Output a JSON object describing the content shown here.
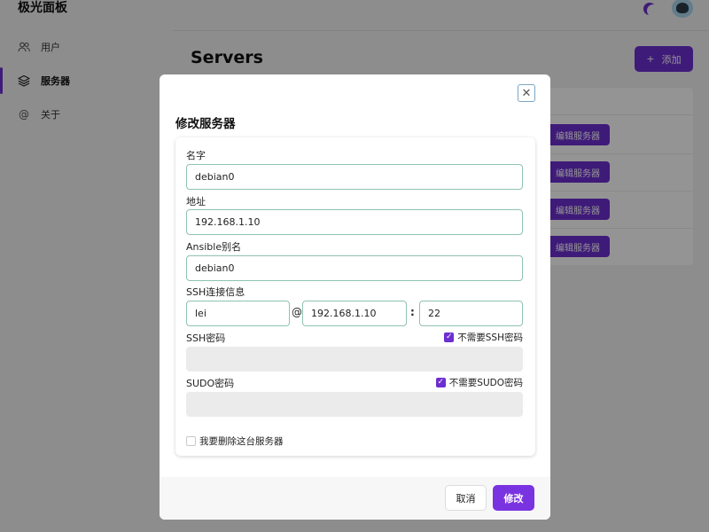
{
  "app": {
    "title": "极光面板"
  },
  "sidebar": {
    "items": [
      {
        "label": "用户",
        "icon": "users-icon"
      },
      {
        "label": "服务器",
        "icon": "layers-icon",
        "active": true
      },
      {
        "label": "关于",
        "icon": "at-icon"
      }
    ]
  },
  "main": {
    "title": "Servers",
    "add_button": "添加",
    "row_action": "编辑服务器",
    "rows": 4
  },
  "modal": {
    "title": "修改服务器",
    "fields": {
      "name": {
        "label": "名字",
        "value": "debian0"
      },
      "address": {
        "label": "地址",
        "value": "192.168.1.10"
      },
      "ansible_alias": {
        "label": "Ansible别名",
        "value": "debian0"
      },
      "ssh": {
        "label": "SSH连接信息",
        "user": "lei",
        "at": "@",
        "host": "192.168.1.10",
        "colon": ":",
        "port": "22"
      },
      "ssh_password": {
        "label": "SSH密码",
        "checkbox_label": "不需要SSH密码",
        "checked": true
      },
      "sudo_password": {
        "label": "SUDO密码",
        "checkbox_label": "不需要SUDO密码",
        "checked": true
      },
      "delete": {
        "label": "我要删除这台服务器",
        "checked": false
      }
    },
    "cancel": "取消",
    "submit": "修改"
  },
  "colors": {
    "accent": "#6d2fd0",
    "input_border": "#8fc3ae"
  }
}
